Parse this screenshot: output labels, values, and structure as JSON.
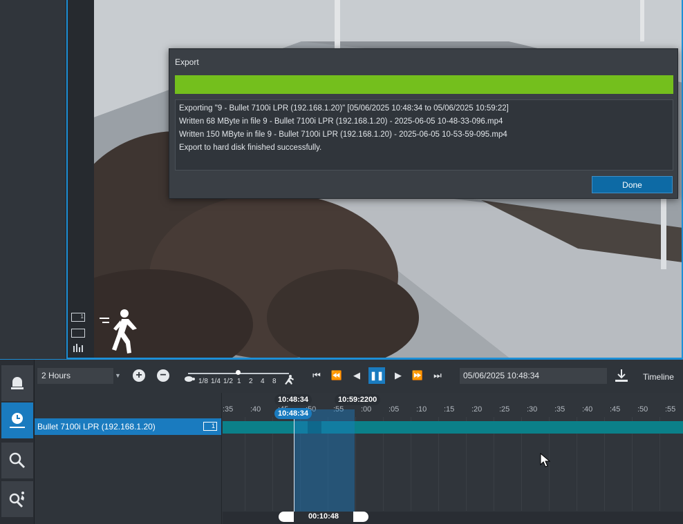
{
  "dialog": {
    "title": "Export",
    "progress": 1.0,
    "log_lines": [
      "Exporting \"9 - Bullet 7100i LPR  (192.168.1.20)\" [05/06/2025 10:48:34 to 05/06/2025 10:59:22]",
      "Written 68 MByte in file 9 - Bullet 7100i LPR  (192.168.1.20) - 2025-06-05 10-48-33-096.mp4",
      "Written 150 MByte in file 9 - Bullet 7100i LPR  (192.168.1.20) - 2025-06-05 10-53-59-095.mp4",
      "Export to hard disk finished successfully."
    ],
    "done_label": "Done"
  },
  "toolbar": {
    "duration": "2 Hours",
    "speeds": [
      "1/8",
      "1/4",
      "1/2",
      "1",
      "2",
      "4",
      "8"
    ],
    "datetime": "05/06/2025 10:48:34",
    "timeline_label": "Timeline"
  },
  "camera": {
    "name": "Bullet 7100i LPR  (192.168.1.20)",
    "badge": "1"
  },
  "timeline": {
    "start_marker": "10:48:34",
    "end_marker": "10:59:22",
    "end_marker_suffix": "00",
    "current": "10:48:34",
    "duration": "00:10:48",
    "ticks": [
      ":35",
      ":40",
      ":45",
      ":50",
      ":55",
      ":00",
      ":05",
      ":10",
      ":15",
      ":20",
      ":25",
      ":30",
      ":35",
      ":40",
      ":45",
      ":50",
      ":55"
    ]
  },
  "colors": {
    "accent": "#1a7bbf",
    "progress": "#74bf1d",
    "track": "#0b8089"
  }
}
